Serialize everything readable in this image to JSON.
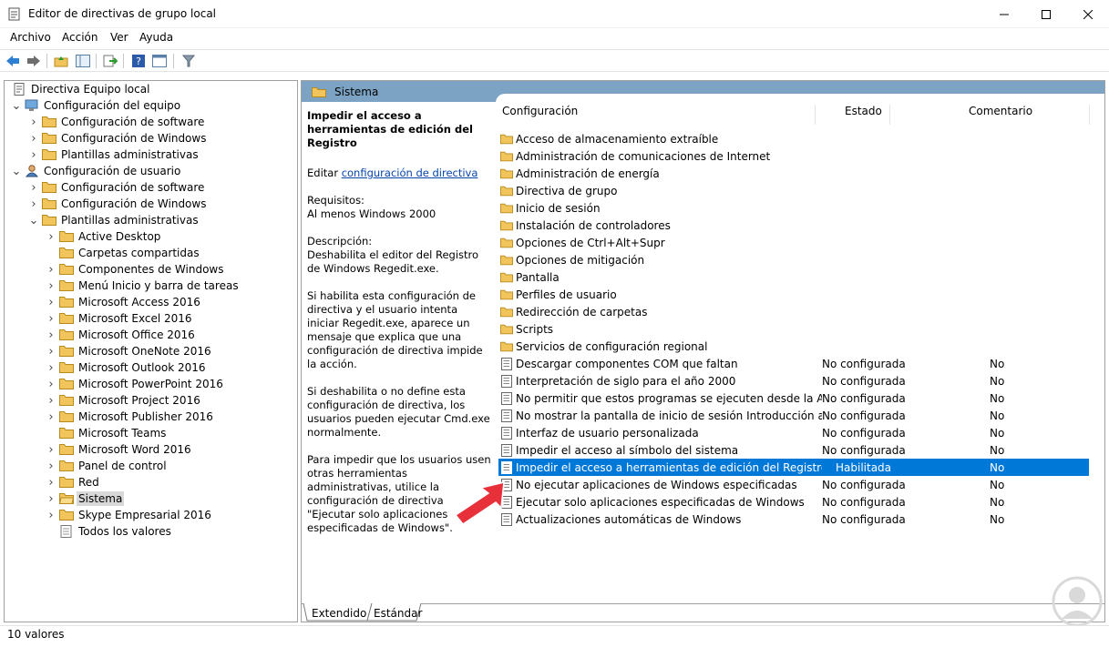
{
  "window": {
    "title": "Editor de directivas de grupo local"
  },
  "menu": [
    "Archivo",
    "Acción",
    "Ver",
    "Ayuda"
  ],
  "tree": [
    {
      "label": "Directiva Equipo local",
      "depth": 0,
      "exp": "",
      "icon": "policy"
    },
    {
      "label": "Configuración del equipo",
      "depth": 1,
      "exp": "v",
      "icon": "computer"
    },
    {
      "label": "Configuración de software",
      "depth": 2,
      "exp": ">",
      "icon": "folder"
    },
    {
      "label": "Configuración de Windows",
      "depth": 2,
      "exp": ">",
      "icon": "folder"
    },
    {
      "label": "Plantillas administrativas",
      "depth": 2,
      "exp": ">",
      "icon": "folder"
    },
    {
      "label": "Configuración de usuario",
      "depth": 1,
      "exp": "v",
      "icon": "user"
    },
    {
      "label": "Configuración de software",
      "depth": 2,
      "exp": ">",
      "icon": "folder"
    },
    {
      "label": "Configuración de Windows",
      "depth": 2,
      "exp": ">",
      "icon": "folder"
    },
    {
      "label": "Plantillas administrativas",
      "depth": 2,
      "exp": "v",
      "icon": "folder"
    },
    {
      "label": "Active Desktop",
      "depth": 3,
      "exp": ">",
      "icon": "folder"
    },
    {
      "label": "Carpetas compartidas",
      "depth": 3,
      "exp": "",
      "icon": "folder"
    },
    {
      "label": "Componentes de Windows",
      "depth": 3,
      "exp": ">",
      "icon": "folder"
    },
    {
      "label": "Menú Inicio y barra de tareas",
      "depth": 3,
      "exp": ">",
      "icon": "folder"
    },
    {
      "label": "Microsoft Access 2016",
      "depth": 3,
      "exp": ">",
      "icon": "folder"
    },
    {
      "label": "Microsoft Excel 2016",
      "depth": 3,
      "exp": ">",
      "icon": "folder"
    },
    {
      "label": "Microsoft Office 2016",
      "depth": 3,
      "exp": ">",
      "icon": "folder"
    },
    {
      "label": "Microsoft OneNote 2016",
      "depth": 3,
      "exp": ">",
      "icon": "folder"
    },
    {
      "label": "Microsoft Outlook 2016",
      "depth": 3,
      "exp": ">",
      "icon": "folder"
    },
    {
      "label": "Microsoft PowerPoint 2016",
      "depth": 3,
      "exp": ">",
      "icon": "folder"
    },
    {
      "label": "Microsoft Project 2016",
      "depth": 3,
      "exp": ">",
      "icon": "folder"
    },
    {
      "label": "Microsoft Publisher 2016",
      "depth": 3,
      "exp": ">",
      "icon": "folder"
    },
    {
      "label": "Microsoft Teams",
      "depth": 3,
      "exp": "",
      "icon": "folder"
    },
    {
      "label": "Microsoft Word 2016",
      "depth": 3,
      "exp": ">",
      "icon": "folder"
    },
    {
      "label": "Panel de control",
      "depth": 3,
      "exp": ">",
      "icon": "folder"
    },
    {
      "label": "Red",
      "depth": 3,
      "exp": ">",
      "icon": "folder"
    },
    {
      "label": "Sistema",
      "depth": 3,
      "exp": ">",
      "icon": "folder-open",
      "selected": true
    },
    {
      "label": "Skype Empresarial 2016",
      "depth": 3,
      "exp": ">",
      "icon": "folder"
    },
    {
      "label": "Todos los valores",
      "depth": 3,
      "exp": "",
      "icon": "allsettings"
    }
  ],
  "pane_header": "Sistema",
  "description": {
    "title": "Impedir el acceso a herramientas de edición del Registro",
    "edit_prefix": "Editar ",
    "edit_link": "configuración de directiva",
    "requirements": "Requisitos:\nAl menos Windows 2000",
    "description": "Descripción:\nDeshabilita el editor del Registro de Windows Regedit.exe.",
    "p1": "Si habilita esta configuración de directiva y el usuario intenta iniciar Regedit.exe, aparece un mensaje que explica que una configuración de directiva impide la acción.",
    "p2": "Si deshabilita o no define esta configuración de directiva, los usuarios pueden ejecutar Cmd.exe normalmente.",
    "p3": "Para impedir que los usuarios usen otras herramientas administrativas, utilice la configuración de directiva \"Ejecutar solo aplicaciones especificadas de Windows\"."
  },
  "columns": {
    "name": "Configuración",
    "state": "Estado",
    "comment": "Comentario"
  },
  "rows": [
    {
      "name": "Acceso de almacenamiento extraíble",
      "type": "folder",
      "state": "",
      "comment": ""
    },
    {
      "name": "Administración de comunicaciones de Internet",
      "type": "folder",
      "state": "",
      "comment": ""
    },
    {
      "name": "Administración de energía",
      "type": "folder",
      "state": "",
      "comment": ""
    },
    {
      "name": "Directiva de grupo",
      "type": "folder",
      "state": "",
      "comment": ""
    },
    {
      "name": "Inicio de sesión",
      "type": "folder",
      "state": "",
      "comment": ""
    },
    {
      "name": "Instalación de controladores",
      "type": "folder",
      "state": "",
      "comment": ""
    },
    {
      "name": "Opciones de Ctrl+Alt+Supr",
      "type": "folder",
      "state": "",
      "comment": ""
    },
    {
      "name": "Opciones de mitigación",
      "type": "folder",
      "state": "",
      "comment": ""
    },
    {
      "name": "Pantalla",
      "type": "folder",
      "state": "",
      "comment": ""
    },
    {
      "name": "Perfiles de usuario",
      "type": "folder",
      "state": "",
      "comment": ""
    },
    {
      "name": "Redirección de carpetas",
      "type": "folder",
      "state": "",
      "comment": ""
    },
    {
      "name": "Scripts",
      "type": "folder",
      "state": "",
      "comment": ""
    },
    {
      "name": "Servicios de configuración regional",
      "type": "folder",
      "state": "",
      "comment": ""
    },
    {
      "name": "Descargar componentes COM que faltan",
      "type": "setting",
      "state": "No configurada",
      "comment": "No"
    },
    {
      "name": "Interpretación de siglo para el año 2000",
      "type": "setting",
      "state": "No configurada",
      "comment": "No"
    },
    {
      "name": "No permitir que estos programas se ejecuten desde la Ayuda",
      "type": "setting",
      "state": "No configurada",
      "comment": "No"
    },
    {
      "name": "No mostrar la pantalla de inicio de sesión Introducción al ini...",
      "type": "setting",
      "state": "No configurada",
      "comment": "No"
    },
    {
      "name": "Interfaz de usuario personalizada",
      "type": "setting",
      "state": "No configurada",
      "comment": "No"
    },
    {
      "name": "Impedir el acceso al símbolo del sistema",
      "type": "setting",
      "state": "No configurada",
      "comment": "No"
    },
    {
      "name": "Impedir el acceso a herramientas de edición del Registro",
      "type": "setting",
      "state": "Habilitada",
      "comment": "No",
      "selected": true
    },
    {
      "name": "No ejecutar aplicaciones de Windows especificadas",
      "type": "setting",
      "state": "No configurada",
      "comment": "No"
    },
    {
      "name": "Ejecutar solo aplicaciones especificadas de Windows",
      "type": "setting",
      "state": "No configurada",
      "comment": "No"
    },
    {
      "name": "Actualizaciones automáticas de Windows",
      "type": "setting",
      "state": "No configurada",
      "comment": "No"
    }
  ],
  "tabs": [
    "Extendido",
    "Estándar"
  ],
  "status": "10 valores",
  "colors": {
    "header_bar": "#7ca3c4",
    "selection": "#0078d7",
    "folder": "#f2c55c",
    "arrow": "#e8303a"
  }
}
